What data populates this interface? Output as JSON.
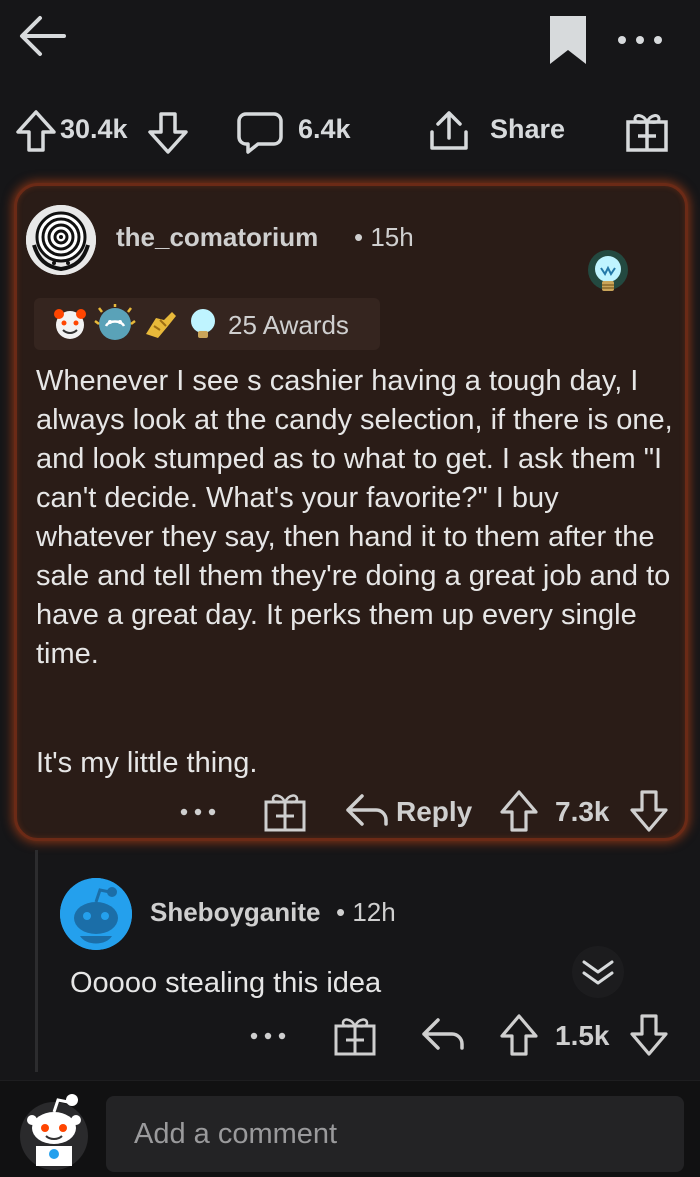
{
  "colors": {
    "background": "#161618",
    "card": "#2a1c17",
    "card_glow": "#d64a16",
    "text": "#d7dadc",
    "avatar_blue": "#24a0ed"
  },
  "topbar": {
    "back_icon": "arrow-left-icon",
    "bookmark_icon": "bookmark-icon",
    "more_icon": "more-horizontal-icon"
  },
  "post_actions": {
    "upvotes": "30.4k",
    "comments": "6.4k",
    "share_label": "Share",
    "gift_icon": "gift-icon"
  },
  "comment": {
    "username": "the_comatorium",
    "time": "• 15h",
    "awards_label": "25 Awards",
    "award_icons": [
      "wholesome-award-icon",
      "helpful-award-icon",
      "respect-award-icon",
      "lightbulb-award-icon"
    ],
    "body": "Whenever I see s cashier having a tough day, I always look at the candy selection, if there is one, and look stumped as to what to get. I ask them \"I can't decide. What's your favorite?\" I buy whatever they say, then hand it to them after the sale and tell them they're doing a great job and to have a great day. It perks them up every single time.",
    "body_2": "It's my little thing.",
    "reply_label": "Reply",
    "score": "7.3k"
  },
  "reply": {
    "username": "Sheboyganite",
    "time": "• 12h",
    "body": "Ooooo stealing this idea",
    "score": "1.5k"
  },
  "bottombar": {
    "placeholder": "Add a comment"
  }
}
